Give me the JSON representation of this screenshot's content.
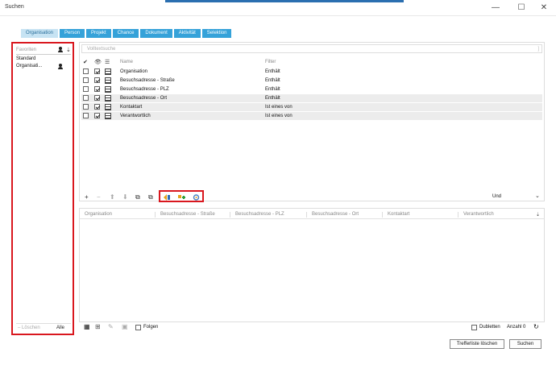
{
  "window": {
    "title": "Suchen",
    "minimize": "—",
    "maximize": "☐",
    "close": "✕"
  },
  "tabs": [
    "Organisation",
    "Person",
    "Projekt",
    "Chance",
    "Dokument",
    "Aktivität",
    "Selektion"
  ],
  "left_panel": {
    "header": "Favoriten",
    "items": [
      {
        "label": "Standard"
      },
      {
        "label": "Organisati..."
      }
    ],
    "delete_label": "Löschen",
    "all_label": "Alle"
  },
  "filter": {
    "search_placeholder": "Volltextsuche",
    "col_name": "Name",
    "col_filter": "Filter",
    "rows": [
      {
        "name": "Organisation",
        "filter": "Enthält",
        "checked": true
      },
      {
        "name": "Besuchsadresse - Straße",
        "filter": "Enthält",
        "checked": true
      },
      {
        "name": "Besuchsadresse - PLZ",
        "filter": "Enthält",
        "checked": true
      },
      {
        "name": "Besuchsadresse - Ort",
        "filter": "Enthält",
        "checked": true
      },
      {
        "name": "Kontaktart",
        "filter": "Ist eines von",
        "checked": true
      },
      {
        "name": "Verantwortlich",
        "filter": "Ist eines von",
        "checked": true
      }
    ],
    "operator": "Und"
  },
  "results": {
    "columns": [
      "Organisation",
      "Besuchsadresse - Straße",
      "Besuchsadresse - PLZ",
      "Besuchsadresse - Ort",
      "Kontaktart",
      "Verantwortlich"
    ]
  },
  "bottom": {
    "follow_label": "Folgen",
    "duplicates_label": "Dubletten",
    "count_label": "Anzahl 0"
  },
  "buttons": {
    "clear": "Trefferliste löschen",
    "search": "Suchen"
  },
  "colors": {
    "tab": "#35a2d9",
    "tab_active": "#c6e3f3",
    "highlight": "#d9171e",
    "titlebar_accent": "#2b6fb0"
  }
}
